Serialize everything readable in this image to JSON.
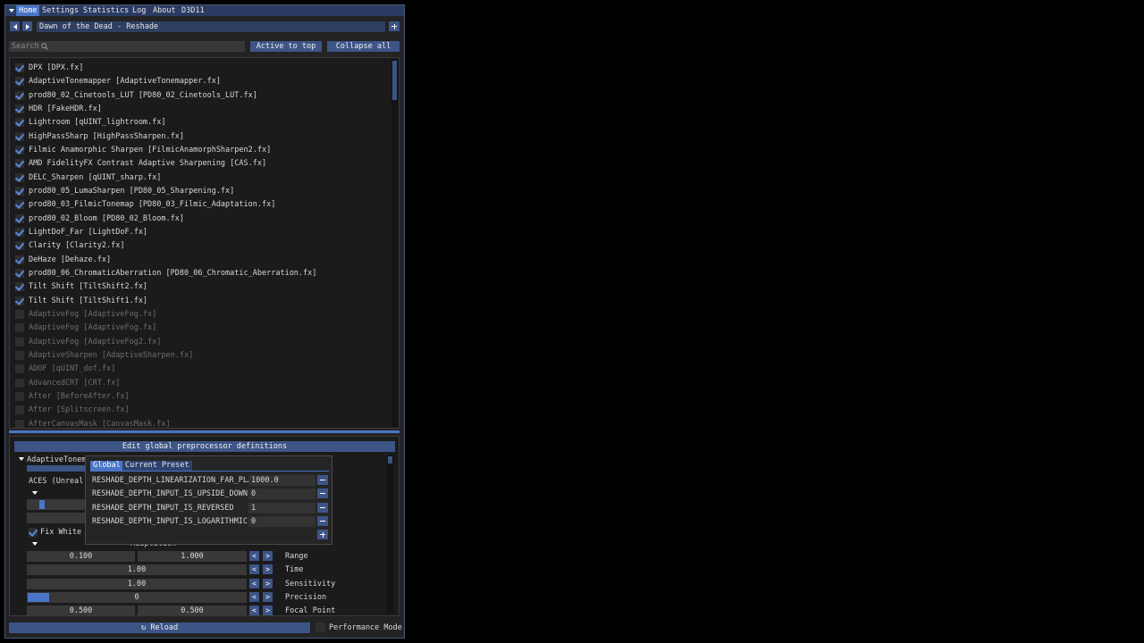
{
  "menu": {
    "items": [
      "Home",
      "Settings",
      "Statistics",
      "Log",
      "About",
      "D3D11"
    ]
  },
  "preset": {
    "name": "Dawn of the Dead - Reshade"
  },
  "search": {
    "placeholder": "Search"
  },
  "toolbar": {
    "active_to_top": "Active to top",
    "collapse_all": "Collapse all"
  },
  "effects": [
    {
      "label": "DPX [DPX.fx]",
      "enabled": true
    },
    {
      "label": "AdaptiveTonemapper [AdaptiveTonemapper.fx]",
      "enabled": true
    },
    {
      "label": "prod80_02_Cinetools_LUT [PD80_02_Cinetools_LUT.fx]",
      "enabled": true
    },
    {
      "label": "HDR [FakeHDR.fx]",
      "enabled": true
    },
    {
      "label": "Lightroom [qUINT_lightroom.fx]",
      "enabled": true
    },
    {
      "label": "HighPassSharp [HighPassSharpen.fx]",
      "enabled": true
    },
    {
      "label": "Filmic Anamorphic Sharpen [FilmicAnamorphSharpen2.fx]",
      "enabled": true
    },
    {
      "label": "AMD FidelityFX Contrast Adaptive Sharpening [CAS.fx]",
      "enabled": true
    },
    {
      "label": "DELC_Sharpen [qUINT_sharp.fx]",
      "enabled": true
    },
    {
      "label": "prod80_05_LumaSharpen [PD80_05_Sharpening.fx]",
      "enabled": true
    },
    {
      "label": "prod80_03_FilmicTonemap [PD80_03_Filmic_Adaptation.fx]",
      "enabled": true
    },
    {
      "label": "prod80_02_Bloom [PD80_02_Bloom.fx]",
      "enabled": true
    },
    {
      "label": "LightDoF_Far [LightDoF.fx]",
      "enabled": true
    },
    {
      "label": "Clarity [Clarity2.fx]",
      "enabled": true
    },
    {
      "label": "DeHaze [Dehaze.fx]",
      "enabled": true
    },
    {
      "label": "prod80_06_ChromaticAberration [PD80_06_Chromatic_Aberration.fx]",
      "enabled": true
    },
    {
      "label": "Tilt Shift [TiltShift2.fx]",
      "enabled": true
    },
    {
      "label": "Tilt Shift [TiltShift1.fx]",
      "enabled": true
    },
    {
      "label": "AdaptiveFog [AdaptiveFog.fx]",
      "enabled": false
    },
    {
      "label": "AdaptiveFog [AdaptiveFog.fx]",
      "enabled": false
    },
    {
      "label": "AdaptiveFog [AdaptiveFog2.fx]",
      "enabled": false
    },
    {
      "label": "AdaptiveSharpen [AdaptiveSharpen.fx]",
      "enabled": false
    },
    {
      "label": "ADOF [qUINT_dof.fx]",
      "enabled": false
    },
    {
      "label": "AdvancedCRT [CRT.fx]",
      "enabled": false
    },
    {
      "label": "After [BeforeAfter.fx]",
      "enabled": false
    },
    {
      "label": "After [Splitscreen.fx]",
      "enabled": false
    },
    {
      "label": "AfterCanvasMask [CanvasMask.fx]",
      "enabled": false
    }
  ],
  "editor": {
    "global_defs_button": "Edit global preprocessor definitions",
    "section_title": "AdaptiveTonema",
    "aces_label": "ACES (Unreal E",
    "fix_white_point": "Fix White Point",
    "adaptation_label": "Adaptation",
    "controls": [
      {
        "values": [
          "0.100",
          "1.000"
        ],
        "label": "Range"
      },
      {
        "values": [
          "1.00"
        ],
        "label": "Time"
      },
      {
        "values": [
          "1.00"
        ],
        "label": "Sensitivity"
      },
      {
        "values": [
          "0"
        ],
        "label": "Precision",
        "fill": 0.1
      },
      {
        "values": [
          "0.500",
          "0.500"
        ],
        "label": "Focal Point"
      }
    ]
  },
  "popup": {
    "tabs": [
      "Global",
      "Current Preset"
    ],
    "definitions": [
      {
        "name": "RESHADE_DEPTH_LINEARIZATION_FAR_PLANE",
        "value": "1000.0"
      },
      {
        "name": "RESHADE_DEPTH_INPUT_IS_UPSIDE_DOWN",
        "value": "0"
      },
      {
        "name": "RESHADE_DEPTH_INPUT_IS_REVERSED",
        "value": "1"
      },
      {
        "name": "RESHADE_DEPTH_INPUT_IS_LOGARITHMIC",
        "value": "0"
      }
    ]
  },
  "footer": {
    "reload": "Reload",
    "performance_mode": "Performance Mode"
  }
}
